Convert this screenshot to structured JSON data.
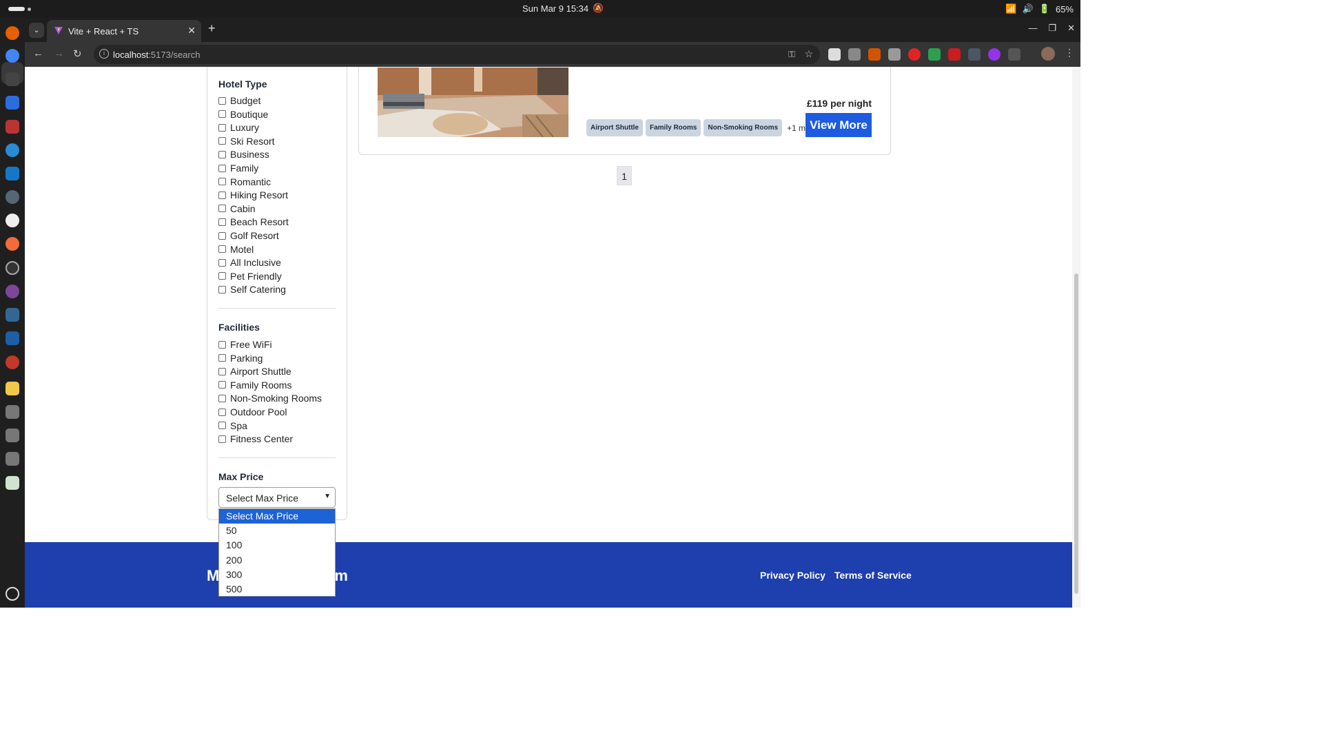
{
  "system": {
    "clock": "Sun Mar 9  15:34",
    "battery": "65%"
  },
  "browser": {
    "tab_title": "Vite + React + TS",
    "new_tab": "+",
    "url_host": "localhost",
    "url_path": ":5173/search"
  },
  "filters": {
    "hotel_type_title": "Hotel Type",
    "hotel_types": [
      "Budget",
      "Boutique",
      "Luxury",
      "Ski Resort",
      "Business",
      "Family",
      "Romantic",
      "Hiking Resort",
      "Cabin",
      "Beach Resort",
      "Golf Resort",
      "Motel",
      "All Inclusive",
      "Pet Friendly",
      "Self Catering"
    ],
    "facilities_title": "Facilities",
    "facilities": [
      "Free WiFi",
      "Parking",
      "Airport Shuttle",
      "Family Rooms",
      "Non-Smoking Rooms",
      "Outdoor Pool",
      "Spa",
      "Fitness Center"
    ],
    "max_price_title": "Max Price",
    "max_price_selected": "Select Max Price",
    "max_price_options": [
      "Select Max Price",
      "50",
      "100",
      "200",
      "300",
      "500"
    ]
  },
  "result": {
    "price": "£119 per night",
    "facility_chips": [
      "Airport Shuttle",
      "Family Rooms",
      "Non-Smoking Rooms"
    ],
    "more": "+1 more",
    "view_more": "View More"
  },
  "pagination": {
    "current": "1"
  },
  "footer": {
    "logo_left": "M",
    "logo_right": "m",
    "privacy": "Privacy Policy",
    "terms": "Terms of Service"
  },
  "colors": {
    "primary": "#1d5be0",
    "footer": "#1e3fae",
    "chip": "#cbd5e1"
  }
}
